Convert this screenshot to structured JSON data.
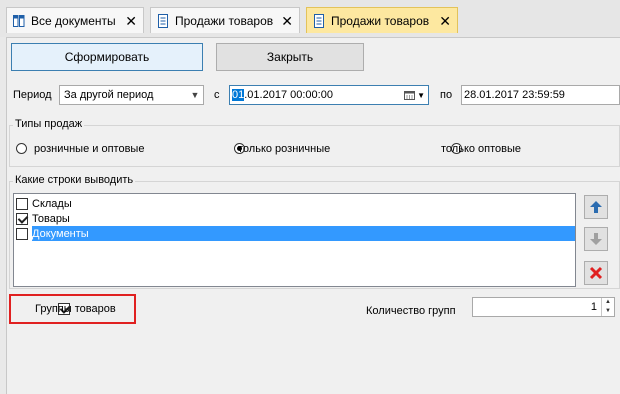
{
  "tabs": [
    {
      "label": "Все документы",
      "close": "✕",
      "icon": "columns-icon"
    },
    {
      "label": "Продажи товаров",
      "close": "✕",
      "icon": "document-icon"
    },
    {
      "label": "Продажи товаров",
      "close": "✕",
      "icon": "document-icon"
    }
  ],
  "toolbar": {
    "generate_label": "Сформировать",
    "close_label": "Закрыть"
  },
  "period": {
    "label": "Период",
    "select_value": "За другой период",
    "from_label": "с",
    "from_value_selected": "01",
    "from_value_rest": ".01.2017 00:00:00",
    "to_label": "по",
    "to_value": "28.01.2017 23:59:59"
  },
  "sale_types": {
    "title": "Типы продаж",
    "options": [
      "розничные и оптовые",
      "только розничные",
      "только оптовые"
    ],
    "selected_index": 1
  },
  "rows_group": {
    "title": "Какие строки выводить",
    "items": [
      {
        "label": "Склады",
        "checked": false
      },
      {
        "label": "Товары",
        "checked": true
      },
      {
        "label": "Документы",
        "checked": false
      }
    ],
    "selected_index": 2
  },
  "product_groups": {
    "label": "Группы товаров",
    "checked": true
  },
  "group_count": {
    "label": "Количество групп",
    "value": "1"
  },
  "colors": {
    "accent": "#0078d7",
    "highlight": "#e02020",
    "active_tab": "#fde8a0"
  }
}
